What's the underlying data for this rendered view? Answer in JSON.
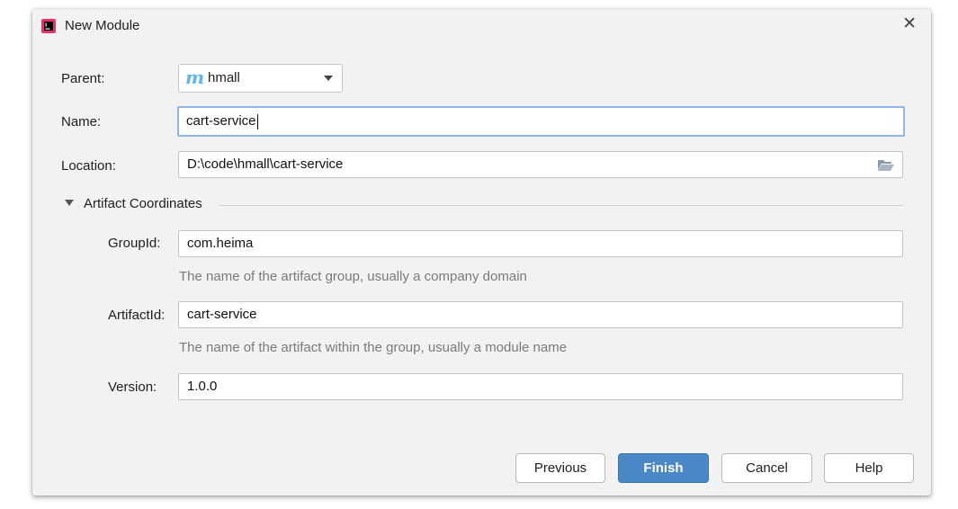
{
  "dialog": {
    "title": "New Module",
    "close_glyph": "✕"
  },
  "form": {
    "parent": {
      "label": "Parent:",
      "value": "hmall",
      "icon_glyph": "m"
    },
    "name": {
      "label": "Name:",
      "value": "cart-service"
    },
    "location": {
      "label": "Location:",
      "value": "D:\\code\\hmall\\cart-service"
    },
    "artifact_section": {
      "title": "Artifact Coordinates"
    },
    "group_id": {
      "label": "GroupId:",
      "value": "com.heima",
      "hint": "The name of the artifact group, usually a company domain"
    },
    "artifact_id": {
      "label": "ArtifactId:",
      "value": "cart-service",
      "hint": "The name of the artifact within the group, usually a module name"
    },
    "version": {
      "label": "Version:",
      "value": "1.0.0"
    }
  },
  "buttons": {
    "previous": "Previous",
    "finish": "Finish",
    "cancel": "Cancel",
    "help": "Help"
  },
  "icons": {
    "app": "intellij-icon",
    "parent": "maven-module-icon",
    "location": "folder-open-icon",
    "section": "chevron-down-icon",
    "close": "close-icon"
  },
  "colors": {
    "primary_button": "#4a88c7",
    "focus_border": "#8fb6e5",
    "maven_icon": "#5fb4e8"
  }
}
